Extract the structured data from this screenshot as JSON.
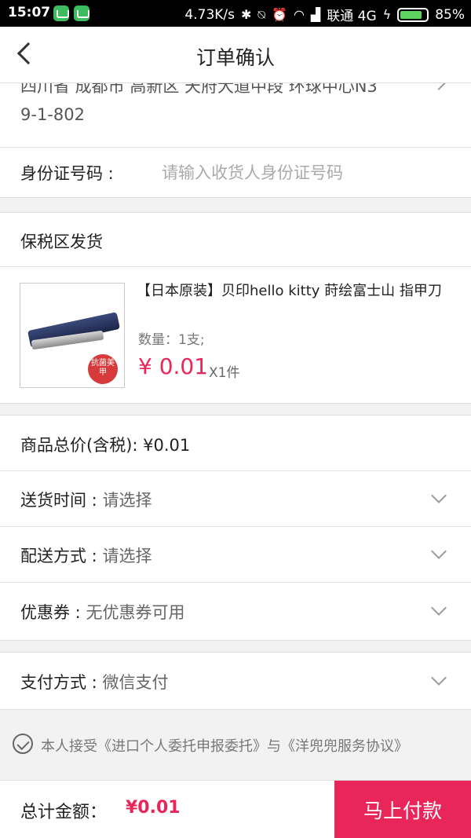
{
  "status": {
    "time": "15:07",
    "speed": "4.73K/s",
    "carrier": "联通 4G",
    "battery": "85%",
    "battery_level": 0.85,
    "battery_color": "#5fd35f"
  },
  "header": {
    "title": "订单确认"
  },
  "address": {
    "line1": "四川省 成都市 高新区 天府大道中段 环球中心N3",
    "line2": "9-1-802"
  },
  "id_field": {
    "label": "身份证号码 :",
    "placeholder": "请输入收货人身份证号码"
  },
  "bonded": {
    "label": "保税区发货"
  },
  "product": {
    "title": "【日本原装】贝印hello kitty 莳绘富士山 指甲刀",
    "quantity": "数量：1支;",
    "price": "¥ 0.01",
    "multiplier": "X1件",
    "stamp_text": "抗菌美甲"
  },
  "summary": {
    "total_price": "商品总价(含税): ¥0.01",
    "delivery_time_label": "送货时间 :",
    "delivery_time_value": "请选择",
    "delivery_method_label": "配送方式 :",
    "delivery_method_value": "请选择",
    "coupon_label": "优惠券 :",
    "coupon_value": "无优惠券可用",
    "payment_label": "支付方式 :",
    "payment_value": "微信支付"
  },
  "agreement": {
    "text": "本人接受《进口个人委托申报委托》与《洋兜兜服务协议》"
  },
  "footer": {
    "total_label": "总计金额：",
    "total_amount": "¥0.01",
    "pay_button": "马上付款",
    "accent": "#e8265a"
  }
}
